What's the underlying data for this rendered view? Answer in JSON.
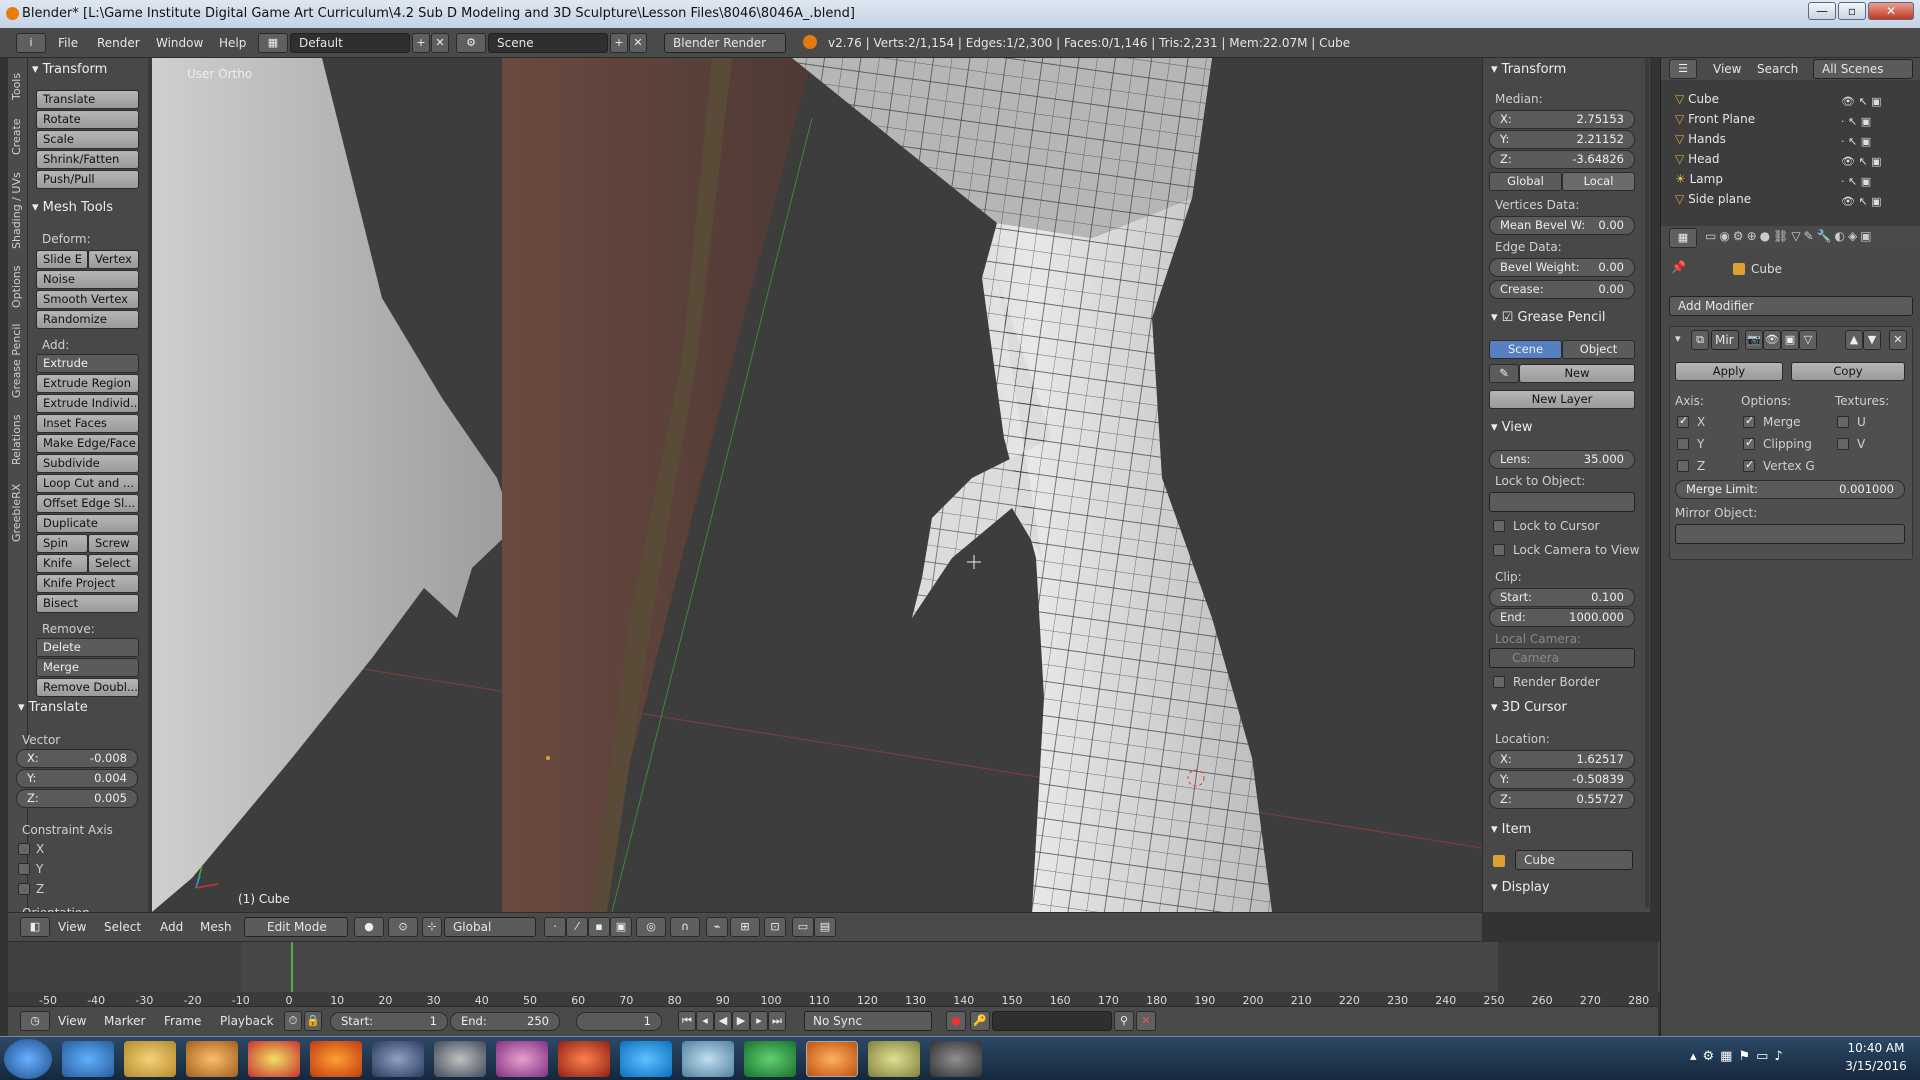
{
  "titlebar": {
    "title": "Blender* [L:\\Game Institute Digital Game Art  Curriculum\\4.2 Sub D Modeling and 3D Sculpture\\Lesson Files\\8046\\8046A_.blend]",
    "btn_min": "—",
    "btn_max": "▫",
    "btn_close": "✕"
  },
  "menubar": {
    "info_icon": "i",
    "menus": [
      "File",
      "Render",
      "Window",
      "Help"
    ],
    "layout_value": "Default",
    "scene_value": "Scene",
    "engine_value": "Blender Render",
    "stats": "v2.76 | Verts:2/1,154 | Edges:1/2,300 | Faces:0/1,146 | Tris:2,231 | Mem:22.07M | Cube"
  },
  "left_tabs": [
    "Tools",
    "Create",
    "Shading / UVs",
    "Options",
    "Grease Pencil",
    "Relations",
    "GreebleRX"
  ],
  "toolshelf": {
    "transform_header": "Transform",
    "transform_buttons": [
      "Translate",
      "Rotate",
      "Scale",
      "Shrink/Fatten",
      "Push/Pull"
    ],
    "mesh_tools_header": "Mesh Tools",
    "deform_label": "Deform:",
    "slide_edge": "Slide E",
    "vertex": "Vertex",
    "deform_buttons": [
      "Noise",
      "Smooth Vertex",
      "Randomize"
    ],
    "add_label": "Add:",
    "extrude": "Extrude",
    "add_buttons": [
      "Extrude Region",
      "Extrude Individ...",
      "Inset Faces",
      "Make Edge/Face",
      "Subdivide",
      "Loop Cut and ...",
      "Offset Edge Sl...",
      "Duplicate"
    ],
    "spin": "Spin",
    "screw": "Screw",
    "knife": "Knife",
    "select": "Select",
    "knife_project": "Knife Project",
    "bisect": "Bisect",
    "remove_label": "Remove:",
    "delete": "Delete",
    "merge": "Merge",
    "remove_doubles": "Remove Doubl...",
    "translate_header": "Translate",
    "vector_label": "Vector",
    "vector": {
      "x_label": "X:",
      "x": "-0.008",
      "y_label": "Y:",
      "y": "0.004",
      "z_label": "Z:",
      "z": "0.005"
    },
    "constraint_label": "Constraint Axis",
    "constraint_axes": [
      "X",
      "Y",
      "Z"
    ],
    "orientation_label": "Orientation"
  },
  "viewport": {
    "view_label": "User Ortho",
    "object_label": "(1) Cube"
  },
  "npanel": {
    "transform_header": "Transform",
    "median_label": "Median:",
    "median": {
      "x_label": "X:",
      "x": "2.75153",
      "y_label": "Y:",
      "y": "2.21152",
      "z_label": "Z:",
      "z": "-3.64826"
    },
    "global": "Global",
    "local": "Local",
    "vertices_data": "Vertices Data:",
    "mean_bevel_label": "Mean Bevel W:",
    "mean_bevel": "0.00",
    "edge_data": "Edge Data:",
    "bevel_weight_label": "Bevel Weight:",
    "bevel_weight": "0.00",
    "crease_label": "Crease:",
    "crease": "0.00",
    "grease_header": "Grease Pencil",
    "scene_btn": "Scene",
    "object_btn": "Object",
    "new_btn": "New",
    "new_layer_btn": "New Layer",
    "view_header": "View",
    "lens_label": "Lens:",
    "lens": "35.000",
    "lock_to_object": "Lock to Object:",
    "lock_to_cursor": "Lock to Cursor",
    "lock_camera": "Lock Camera to View",
    "clip_label": "Clip:",
    "clip_start_label": "Start:",
    "clip_start": "0.100",
    "clip_end_label": "End:",
    "clip_end": "1000.000",
    "local_camera": "Local Camera:",
    "camera_value": "Camera",
    "render_border": "Render Border",
    "cursor_header": "3D Cursor",
    "location_label": "Location:",
    "cursor": {
      "x_label": "X:",
      "x": "1.62517",
      "y_label": "Y:",
      "y": "-0.50839",
      "z_label": "Z:",
      "z": "0.55727"
    },
    "item_header": "Item",
    "item_name": "Cube",
    "display_header": "Display"
  },
  "vp_header": {
    "menus": [
      "View",
      "Select",
      "Add",
      "Mesh"
    ],
    "mode": "Edit Mode",
    "orientation": "Global"
  },
  "timeline": {
    "ticks": [
      "-50",
      "-40",
      "-30",
      "-20",
      "-10",
      "0",
      "10",
      "20",
      "30",
      "40",
      "50",
      "60",
      "70",
      "80",
      "90",
      "100",
      "110",
      "120",
      "130",
      "140",
      "150",
      "160",
      "170",
      "180",
      "190",
      "200",
      "210",
      "220",
      "230",
      "240",
      "250",
      "260",
      "270",
      "280"
    ],
    "menus": [
      "View",
      "Marker",
      "Frame",
      "Playback"
    ],
    "start_label": "Start:",
    "start": "1",
    "end_label": "End:",
    "end": "250",
    "current": "1",
    "sync": "No Sync"
  },
  "outliner": {
    "view": "View",
    "search": "Search",
    "scenes": "All Scenes",
    "items": [
      "Cube",
      "Front Plane",
      "Hands",
      "Head",
      "Lamp",
      "Side plane"
    ]
  },
  "properties": {
    "object_name": "Cube",
    "add_modifier": "Add Modifier",
    "modifier_name": "Mir",
    "apply": "Apply",
    "copy": "Copy",
    "axis_label": "Axis:",
    "options_label": "Options:",
    "textures_label": "Textures:",
    "axes": [
      "X",
      "Y",
      "Z"
    ],
    "options": [
      "Merge",
      "Clipping",
      "Vertex G"
    ],
    "textures": [
      "U",
      "V"
    ],
    "merge_limit_label": "Merge Limit:",
    "merge_limit": "0.001000",
    "mirror_object": "Mirror Object:"
  },
  "taskbar": {
    "time": "10:40 AM",
    "date": "3/15/2016"
  }
}
